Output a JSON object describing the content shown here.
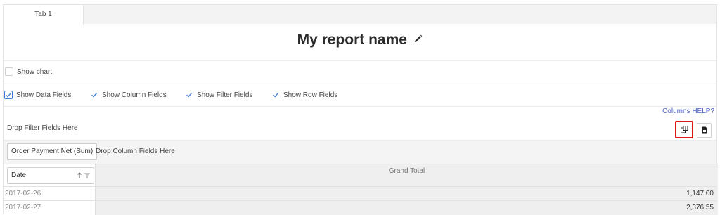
{
  "tabs": [
    {
      "label": "Tab 1"
    }
  ],
  "report": {
    "title": "My report name"
  },
  "options": {
    "show_chart": {
      "label": "Show chart",
      "checked": false
    },
    "fields": [
      {
        "label": "Show Data Fields",
        "checked": true
      },
      {
        "label": "Show Column Fields",
        "checked": true
      },
      {
        "label": "Show Filter Fields",
        "checked": true
      },
      {
        "label": "Show Row Fields",
        "checked": true
      }
    ]
  },
  "pivot": {
    "columns_help": "Columns HELP?",
    "drop_filter": "Drop Filter Fields Here",
    "data_field": "Order Payment Net (Sum)",
    "drop_columns": "Drop Column Fields Here",
    "row_field": "Date",
    "grand_total": "Grand Total",
    "rows": [
      {
        "date": "2017-02-26",
        "value": "1,147.00"
      },
      {
        "date": "2017-02-27",
        "value": "2,376.55"
      }
    ]
  },
  "icons": {
    "edit": "pencil-icon",
    "columns_toggle": "columns-icon",
    "export": "export-file-icon",
    "sort": "sort-arrow-icon",
    "filter": "filter-icon"
  },
  "colors": {
    "accent": "#3a7bd5",
    "link": "#4a5fc1",
    "highlight": "#e01818"
  }
}
